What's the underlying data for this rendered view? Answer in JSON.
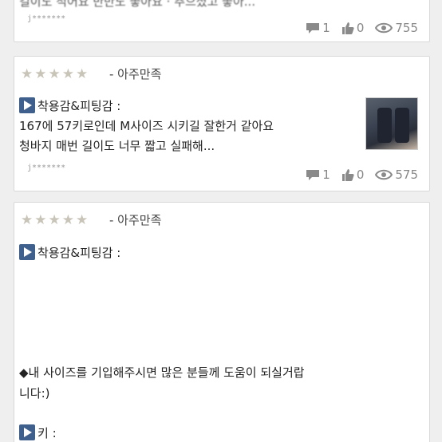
{
  "reviews": [
    {
      "partial_text": "길이도 적어요 반반도 좋아요 · 추으셨고 좋아...",
      "author": "j*******",
      "comments": "1",
      "likes": "0",
      "views": "755"
    },
    {
      "rating_label": "- 아주만족",
      "heading": "착용감&피팅감 :",
      "lines": [
        "167에 57키로인데 M사이즈 시키길 잘한거 같아요",
        "청바지 매번 길이도 너무 짧고 실패해..."
      ],
      "author": "j*******",
      "comments": "1",
      "likes": "0",
      "views": "575"
    },
    {
      "rating_label": "- 아주만족",
      "heading": "착용감&피팅감 :",
      "size_request_1": "◆내 사이즈를 기입해주시면 많은 분들께 도움이 되실거랍",
      "size_request_2": "니다:)",
      "height_label": "키 :"
    }
  ],
  "icons": {
    "comment": "comment-icon",
    "like": "thumbs-up-icon",
    "views": "eye-icon",
    "star": "star-icon",
    "play": "play-icon"
  },
  "colors": {
    "star": "#c9c4b8",
    "play": "#3f5f8c",
    "stat": "#888888"
  }
}
